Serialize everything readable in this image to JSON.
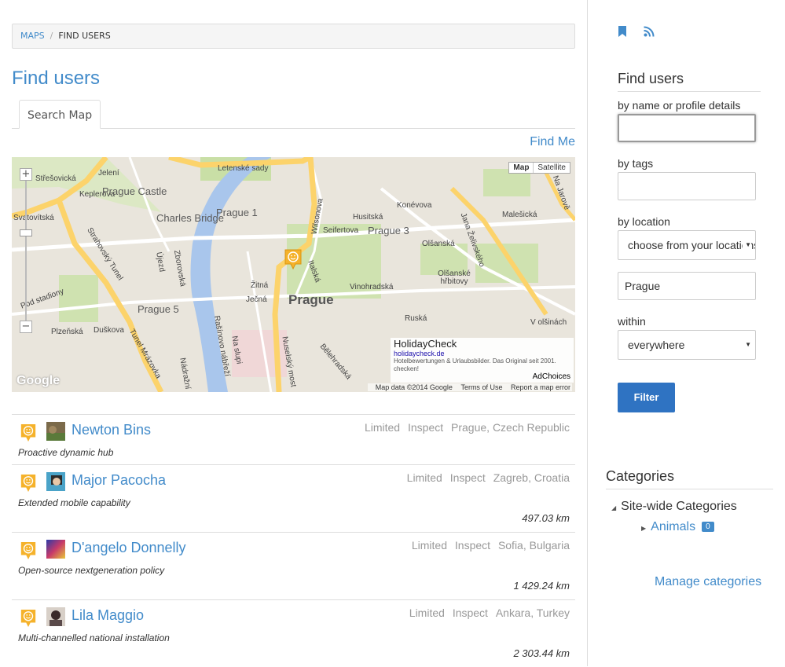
{
  "breadcrumb": {
    "root": "MAPS",
    "current": "FIND USERS"
  },
  "page_title": "Find users",
  "tabs": [
    {
      "label": "Search Map"
    }
  ],
  "find_me": "Find Me",
  "map": {
    "type_map": "Map",
    "type_satellite": "Satellite",
    "labels": {
      "l1": "Letenské sady",
      "l2": "Jelení",
      "l3": "Střešovická",
      "l4": "Keplerova",
      "l5": "Prague Castle",
      "l6": "Charles Bridge",
      "l7": "Prague 1",
      "l8": "Prague 3",
      "l9": "Prague",
      "l10": "Prague 5",
      "l11": "Strahovský Tunel",
      "l12": "Tunel Mrázovka",
      "l13": "Plzeňská",
      "l14": "Duškova",
      "l15": "Vinohradská",
      "l16": "Olšanské hřbitovy",
      "l17": "Konévova",
      "l18": "Seifertova",
      "l19": "Husitská",
      "l20": "Malešická",
      "l21": "Ruská",
      "l22": "Bělehradská",
      "l23": "Nuselský most",
      "l24": "Žitná",
      "l25": "Ječná",
      "l26": "Italská",
      "l27": "Wilsonova",
      "l28": "Olšanská",
      "l29": "V olšinách",
      "l30": "Na Jarově",
      "l31": "Zborovská",
      "l32": "Újezd",
      "l33": "Rašínovo nábřeží",
      "l34": "Na slupi",
      "l35": "Jana Želivského",
      "l36": "Pod stadiony",
      "l37": "Nádražní",
      "l38": "Svatovítská"
    },
    "ad": {
      "title": "HolidayCheck",
      "url": "holidaycheck.de",
      "desc": "Hotelbewertungen & Urlaubsbilder. Das Original seit 2001. checken!",
      "choices": "AdChoices"
    },
    "footer": {
      "data": "Map data ©2014 Google",
      "terms": "Terms of Use",
      "report": "Report a map error"
    },
    "logo": "Google"
  },
  "users": [
    {
      "name": "Newton Bins",
      "limited": "Limited",
      "inspect": "Inspect",
      "location": "Prague, Czech Republic",
      "desc": "Proactive dynamic hub",
      "distance": ""
    },
    {
      "name": "Major Pacocha",
      "limited": "Limited",
      "inspect": "Inspect",
      "location": "Zagreb, Croatia",
      "desc": "Extended mobile capability",
      "distance": "497.03 km"
    },
    {
      "name": "D'angelo Donnelly",
      "limited": "Limited",
      "inspect": "Inspect",
      "location": "Sofia, Bulgaria",
      "desc": "Open-source nextgeneration policy",
      "distance": "1 429.24 km"
    },
    {
      "name": "Lila Maggio",
      "limited": "Limited",
      "inspect": "Inspect",
      "location": "Ankara, Turkey",
      "desc": "Multi-channelled national installation",
      "distance": "2 303.44 km"
    }
  ],
  "sidebar": {
    "title": "Find users",
    "by_name_label": "by name or profile details",
    "by_name_value": "",
    "by_tags_label": "by tags",
    "by_tags_value": "",
    "by_location_label": "by location",
    "location_select": "choose from your locations",
    "location_value": "Prague",
    "within_label": "within",
    "within_select": "everywhere",
    "filter_button": "Filter",
    "categories_title": "Categories",
    "site_wide": "Site-wide Categories",
    "animals": "Animals",
    "animals_count": "0",
    "manage": "Manage categories"
  },
  "colors": {
    "link": "#428bca",
    "button": "#2f73c2",
    "marker": "#f5b22b"
  }
}
